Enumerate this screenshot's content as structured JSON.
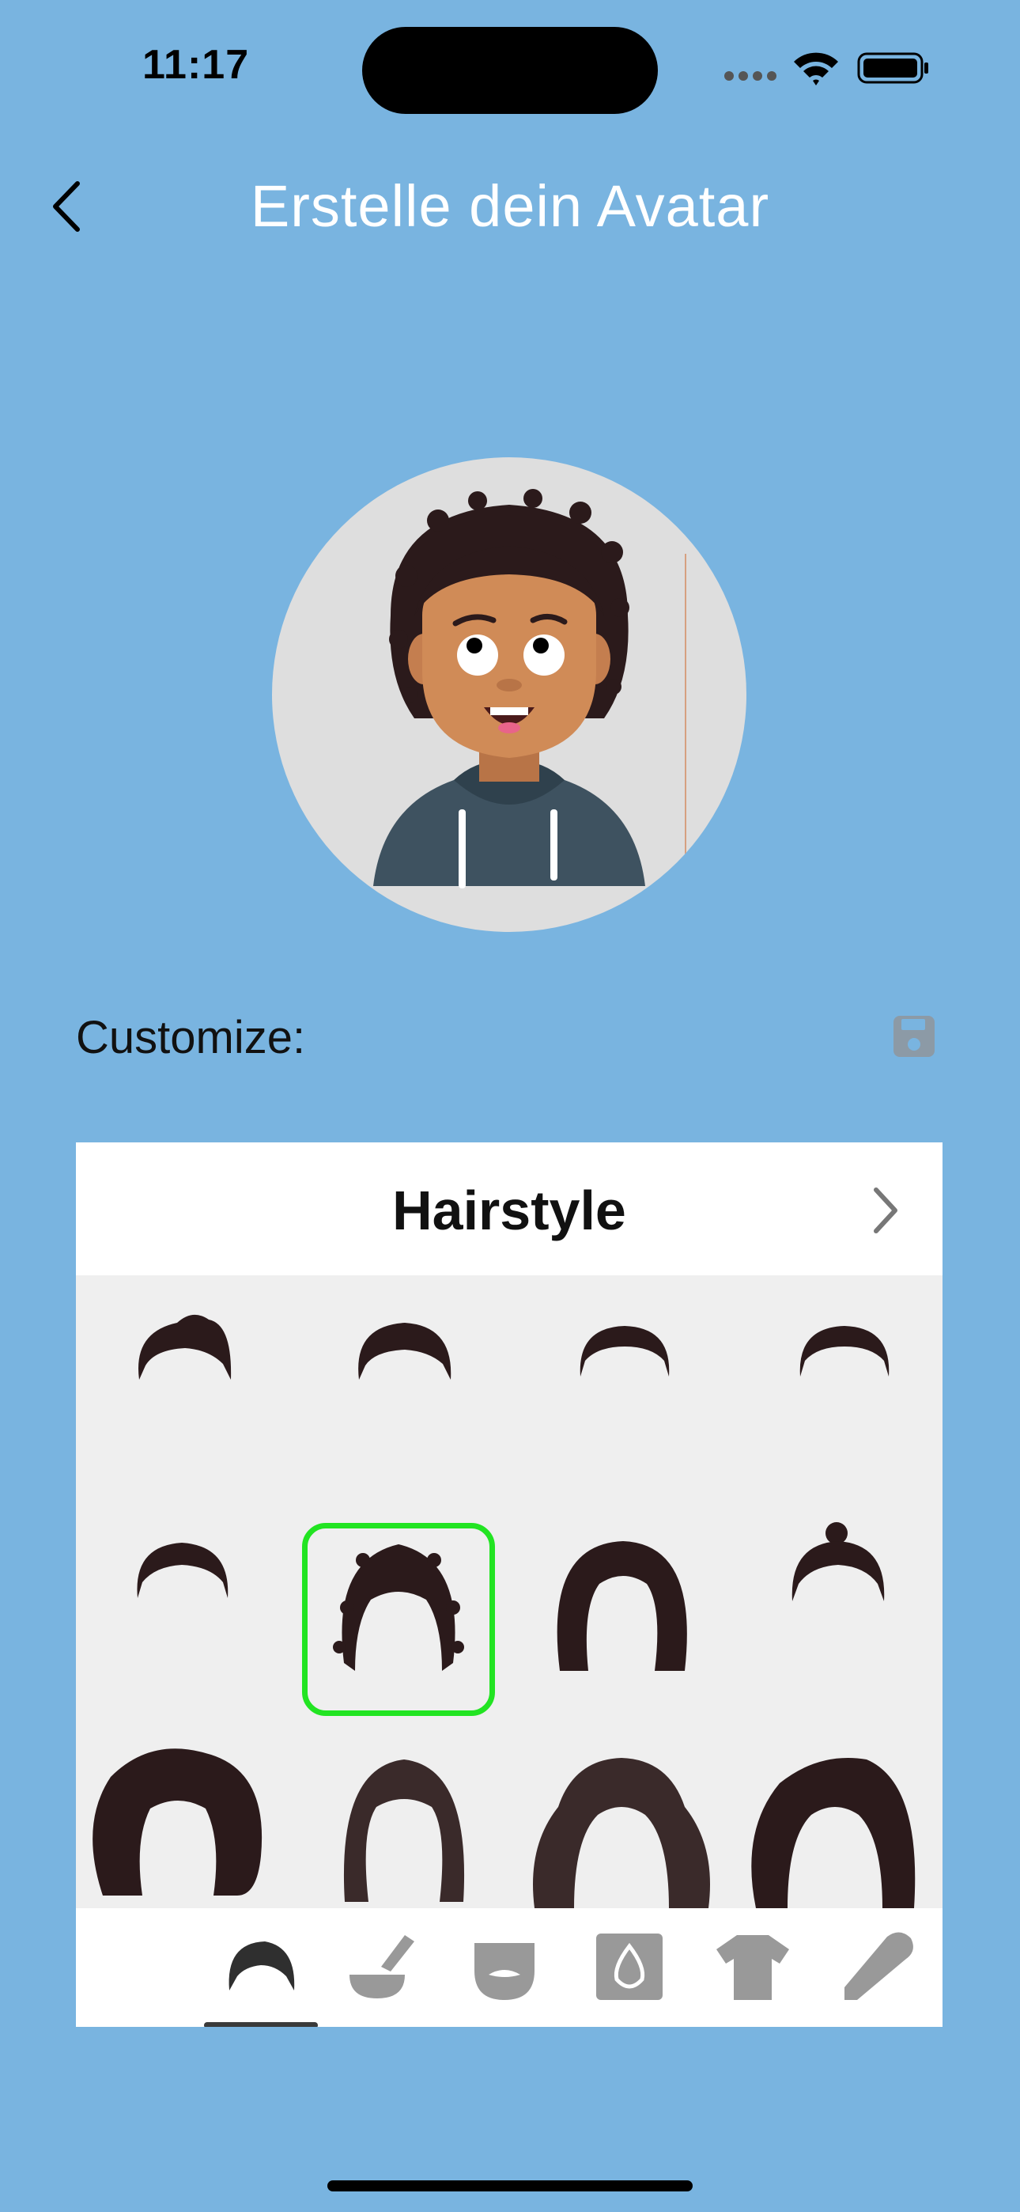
{
  "status_bar": {
    "time": "11:17"
  },
  "nav": {
    "title": "Erstelle dein Avatar"
  },
  "customize": {
    "label": "Customize:"
  },
  "panel": {
    "title": "Hairstyle",
    "hairstyles": [
      {
        "name": "short-hair-1-icon"
      },
      {
        "name": "short-hair-2-icon"
      },
      {
        "name": "short-hair-3-icon"
      },
      {
        "name": "short-hair-4-icon"
      },
      {
        "name": "short-hair-5-icon"
      },
      {
        "name": "curly-hair-icon",
        "selected": true
      },
      {
        "name": "bob-hair-icon"
      },
      {
        "name": "bun-hair-icon"
      },
      {
        "name": "afro-hair-icon"
      },
      {
        "name": "long-bob-hair-icon"
      },
      {
        "name": "wavy-hair-icon"
      },
      {
        "name": "long-curly-hair-icon"
      }
    ],
    "tabs": [
      {
        "name": "tab-hairstyle",
        "icon": "hair-icon",
        "active": true
      },
      {
        "name": "tab-hair-color",
        "icon": "hair-dye-icon"
      },
      {
        "name": "tab-beard",
        "icon": "beard-icon"
      },
      {
        "name": "tab-skin-tone",
        "icon": "skin-tone-icon"
      },
      {
        "name": "tab-clothing",
        "icon": "tshirt-icon"
      },
      {
        "name": "tab-color-picker",
        "icon": "eyedropper-icon"
      }
    ]
  },
  "colors": {
    "background": "#79b4e0",
    "selection": "#22e422",
    "hair": "#2b1a1b",
    "skin": "#d08b57",
    "hoodie": "#3e5260"
  }
}
